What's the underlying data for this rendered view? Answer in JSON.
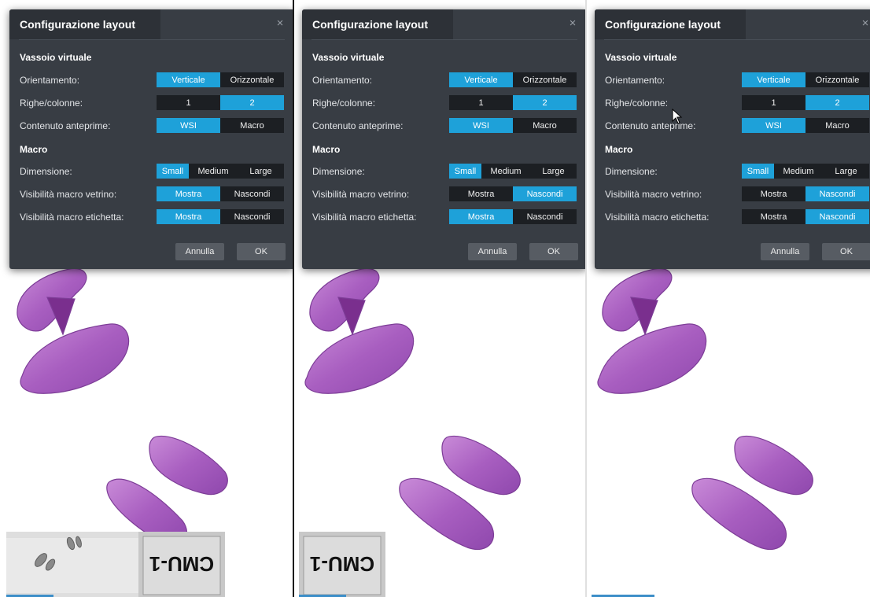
{
  "dialogs": [
    {
      "title": "Configurazione layout",
      "close_glyph": "×",
      "sections": {
        "tray": "Vassoio virtuale",
        "macro": "Macro"
      },
      "labels": {
        "orientation": "Orientamento:",
        "rows_cols": "Righe/colonne:",
        "preview_content": "Contenuto anteprime:",
        "size": "Dimensione:",
        "slide_macro_visibility": "Visibilità macro vetrino:",
        "label_macro_visibility": "Visibilità macro etichetta:"
      },
      "options": {
        "orientation": [
          "Verticale",
          "Orizzontale"
        ],
        "rows_cols": [
          "1",
          "2"
        ],
        "preview_content": [
          "WSI",
          "Macro"
        ],
        "size": [
          "Small",
          "Medium",
          "Large"
        ],
        "slide_macro_visibility": [
          "Mostra",
          "Nascondi"
        ],
        "label_macro_visibility": [
          "Mostra",
          "Nascondi"
        ]
      },
      "selected": {
        "orientation": "Verticale",
        "rows_cols": "2",
        "preview_content": "WSI",
        "size": "Small",
        "slide_macro_visibility": "Mostra",
        "label_macro_visibility": "Mostra"
      },
      "buttons": {
        "cancel": "Annulla",
        "ok": "OK"
      }
    },
    {
      "title": "Configurazione layout",
      "close_glyph": "×",
      "sections": {
        "tray": "Vassoio virtuale",
        "macro": "Macro"
      },
      "labels": {
        "orientation": "Orientamento:",
        "rows_cols": "Righe/colonne:",
        "preview_content": "Contenuto anteprime:",
        "size": "Dimensione:",
        "slide_macro_visibility": "Visibilità macro vetrino:",
        "label_macro_visibility": "Visibilità macro etichetta:"
      },
      "options": {
        "orientation": [
          "Verticale",
          "Orizzontale"
        ],
        "rows_cols": [
          "1",
          "2"
        ],
        "preview_content": [
          "WSI",
          "Macro"
        ],
        "size": [
          "Small",
          "Medium",
          "Large"
        ],
        "slide_macro_visibility": [
          "Mostra",
          "Nascondi"
        ],
        "label_macro_visibility": [
          "Mostra",
          "Nascondi"
        ]
      },
      "selected": {
        "orientation": "Verticale",
        "rows_cols": "2",
        "preview_content": "WSI",
        "size": "Small",
        "slide_macro_visibility": "Nascondi",
        "label_macro_visibility": "Mostra"
      },
      "buttons": {
        "cancel": "Annulla",
        "ok": "OK"
      }
    },
    {
      "title": "Configurazione layout",
      "close_glyph": "×",
      "sections": {
        "tray": "Vassoio virtuale",
        "macro": "Macro"
      },
      "labels": {
        "orientation": "Orientamento:",
        "rows_cols": "Righe/colonne:",
        "preview_content": "Contenuto anteprime:",
        "size": "Dimensione:",
        "slide_macro_visibility": "Visibilità macro vetrino:",
        "label_macro_visibility": "Visibilità macro etichetta:"
      },
      "options": {
        "orientation": [
          "Verticale",
          "Orizzontale"
        ],
        "rows_cols": [
          "1",
          "2"
        ],
        "preview_content": [
          "WSI",
          "Macro"
        ],
        "size": [
          "Small",
          "Medium",
          "Large"
        ],
        "slide_macro_visibility": [
          "Mostra",
          "Nascondi"
        ],
        "label_macro_visibility": [
          "Mostra",
          "Nascondi"
        ]
      },
      "selected": {
        "orientation": "Verticale",
        "rows_cols": "2",
        "preview_content": "WSI",
        "size": "Small",
        "slide_macro_visibility": "Nascondi",
        "label_macro_visibility": "Nascondi"
      },
      "buttons": {
        "cancel": "Annulla",
        "ok": "OK"
      }
    }
  ],
  "macro_label_text": "CMU-1",
  "colors": {
    "accent": "#1ea1d9",
    "dialog_bg": "#383d44",
    "segment_bg": "#1c1f23",
    "tissue": "#b266c7"
  }
}
